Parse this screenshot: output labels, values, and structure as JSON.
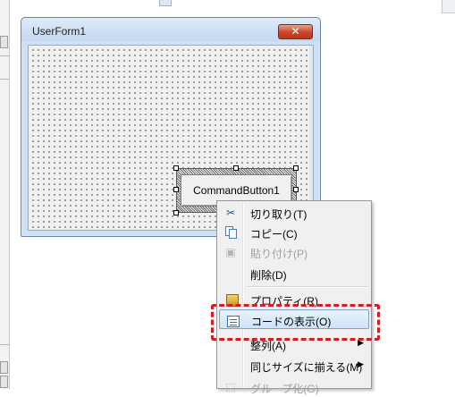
{
  "userform": {
    "title": "UserForm1",
    "close_glyph": "✕",
    "command_button_label": "CommandButton1"
  },
  "context_menu": {
    "items": [
      {
        "label": "切り取り(T)",
        "icon": "scissors-icon",
        "enabled": true
      },
      {
        "label": "コピー(C)",
        "icon": "copy-icon",
        "enabled": true
      },
      {
        "label": "貼り付け(P)",
        "icon": "paste-icon",
        "enabled": false
      },
      {
        "label": "削除(D)",
        "icon": "",
        "enabled": true
      },
      {
        "label": "プロパティ(R)",
        "icon": "properties-icon",
        "enabled": true
      },
      {
        "label": "コードの表示(O)",
        "icon": "view-code-icon",
        "enabled": true,
        "highlighted": true
      },
      {
        "label": "整列(A)",
        "icon": "",
        "enabled": true,
        "submenu": true
      },
      {
        "label": "同じサイズに揃える(M)",
        "icon": "",
        "enabled": true,
        "submenu": true
      },
      {
        "label": "グループ化(G)",
        "icon": "group-icon",
        "enabled": false
      }
    ],
    "submenu_arrow": "▶"
  },
  "annotation": {
    "color": "#d21f25",
    "target": "コードの表示(O)"
  },
  "colors": {
    "title_bar": "#cde0f4",
    "close_button": "#c8442a",
    "menu_highlight": "#cfe3f8"
  }
}
